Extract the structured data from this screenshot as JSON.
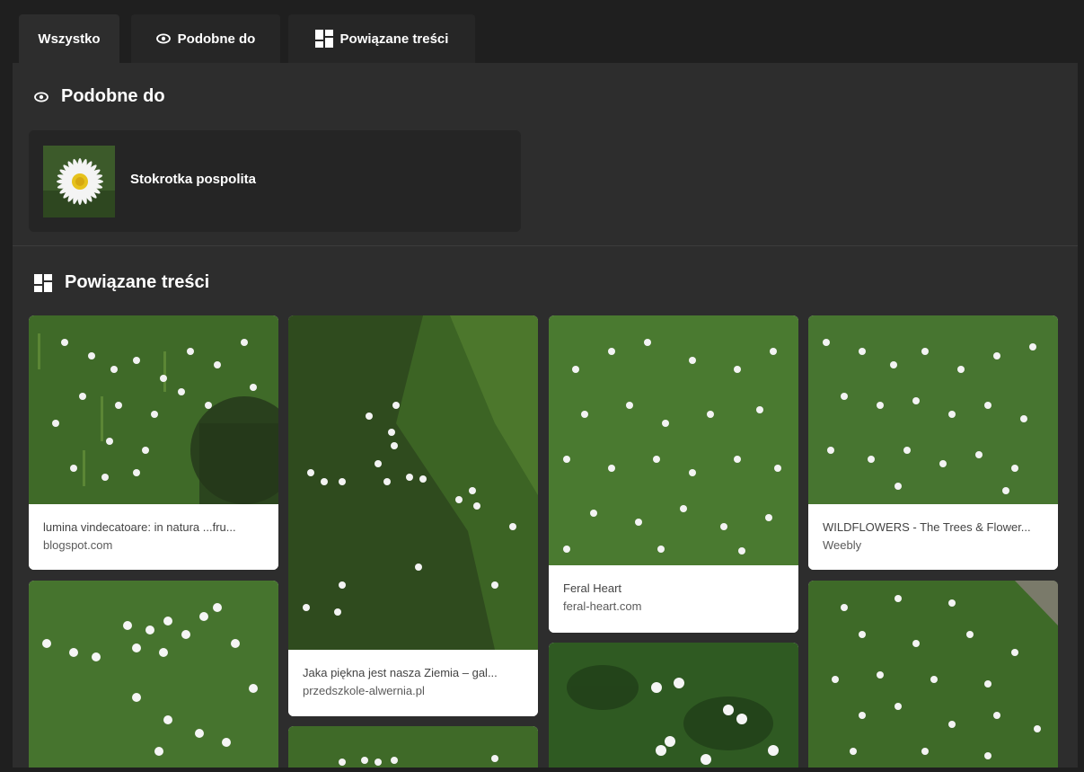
{
  "tabs": [
    {
      "label": "Wszystko",
      "active": true
    },
    {
      "label": "Podobne do",
      "icon": "eye-icon"
    },
    {
      "label": "Powiązane treści",
      "icon": "grid-icon"
    }
  ],
  "similar_section": {
    "title": "Podobne do",
    "icon": "eye-icon",
    "item": {
      "label": "Stokrotka pospolita",
      "image": "daisy-flower-thumbnail"
    }
  },
  "related_section": {
    "title": "Powiązane treści",
    "icon": "grid-icon",
    "results": [
      {
        "title": "lumina vindecatoare: in natura ...fru...",
        "source": "blogspot.com",
        "image": "daisy-lawn-photo"
      },
      {
        "title": "",
        "source": "",
        "image": "daisy-lawn-photo"
      },
      {
        "title": "Jaka piękna jest nasza Ziemia – gal...",
        "source": "przedszkole-alwernia.pl",
        "image": "daisy-lawn-photo"
      },
      {
        "title": "",
        "source": "",
        "image": "daisy-lawn-photo"
      },
      {
        "title": "Feral Heart",
        "source": "feral-heart.com",
        "image": "daisy-lawn-photo"
      },
      {
        "title": "",
        "source": "",
        "image": "daisy-lawn-photo"
      },
      {
        "title": "WILDFLOWERS - The Trees & Flower...",
        "source": "Weebly",
        "image": "daisy-lawn-photo"
      },
      {
        "title": "",
        "source": "",
        "image": "daisy-lawn-photo"
      }
    ]
  },
  "colors": {
    "background": "#1f1f1f",
    "panel": "#2d2d2d",
    "card_caption": "#ffffff",
    "grass": "#3f6a28"
  }
}
